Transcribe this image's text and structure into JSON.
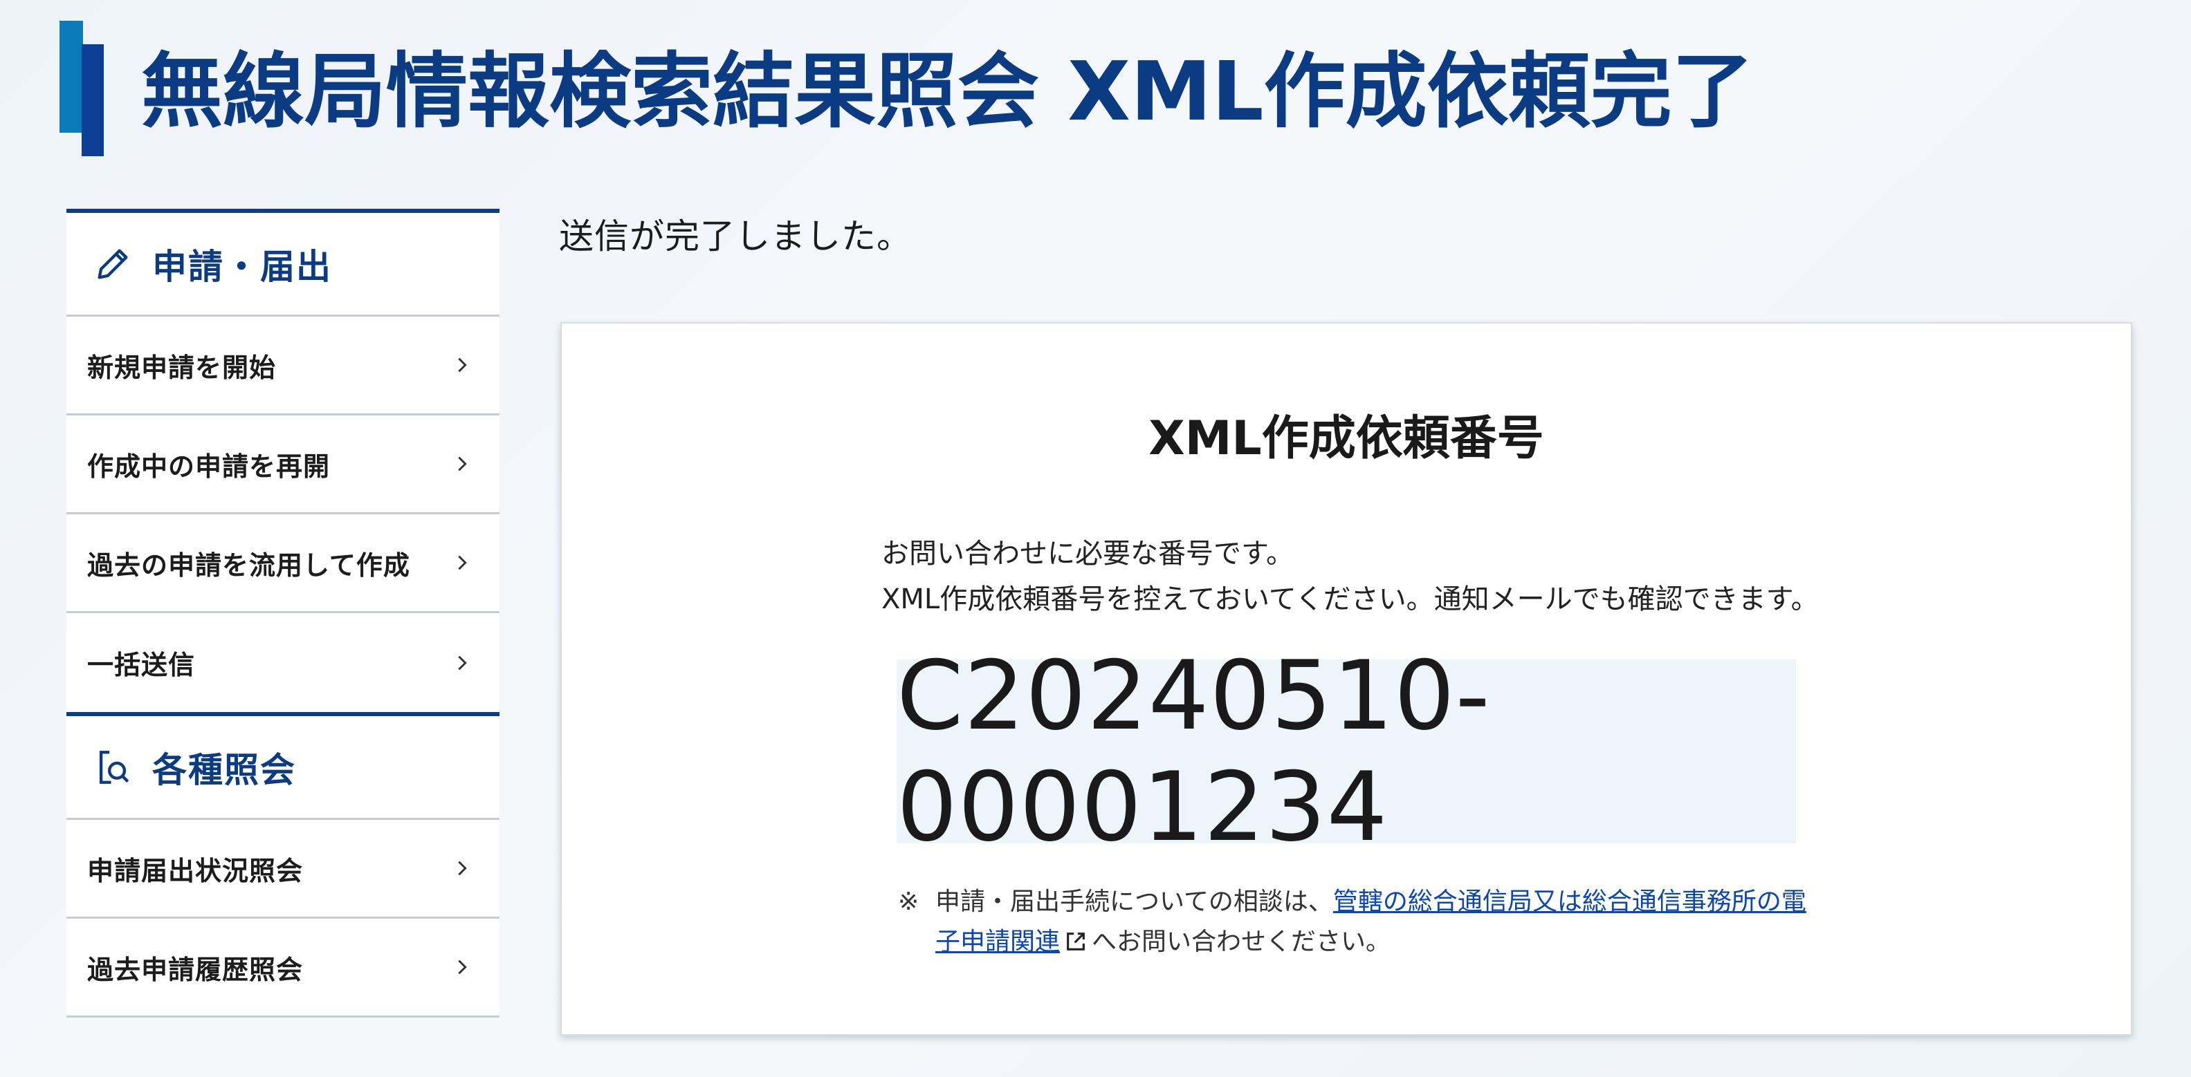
{
  "page": {
    "title": "無線局情報検索結果照会 XML作成依頼完了"
  },
  "sidebar": {
    "sections": [
      {
        "title": "申請・届出",
        "icon": "pencil-icon",
        "items": [
          {
            "label": "新規申請を開始"
          },
          {
            "label": "作成中の申請を再開"
          },
          {
            "label": "過去の申請を流用して作成"
          },
          {
            "label": "一括送信"
          }
        ]
      },
      {
        "title": "各種照会",
        "icon": "document-search-icon",
        "items": [
          {
            "label": "申請届出状況照会"
          },
          {
            "label": "過去申請履歴照会"
          }
        ]
      }
    ]
  },
  "main": {
    "lead": "送信が完了しました。",
    "card": {
      "heading": "XML作成依頼番号",
      "desc_line1": "お問い合わせに必要な番号です。",
      "desc_line2": "XML作成依頼番号を控えておいてください。通知メールでも確認できます。",
      "request_number": "C20240510-00001234",
      "note": {
        "mark": "※",
        "prefix": "申請・届出手続についての相談は、",
        "link_text": "管轄の総合通信局又は総合通信事務所の電子申請関連",
        "suffix": "へお問い合わせください。"
      }
    }
  },
  "colors": {
    "brand_navy": "#0b3b82",
    "accent_teal": "#0a7ab8",
    "link": "#0b46b5",
    "number_bg": "#edf5fa"
  }
}
